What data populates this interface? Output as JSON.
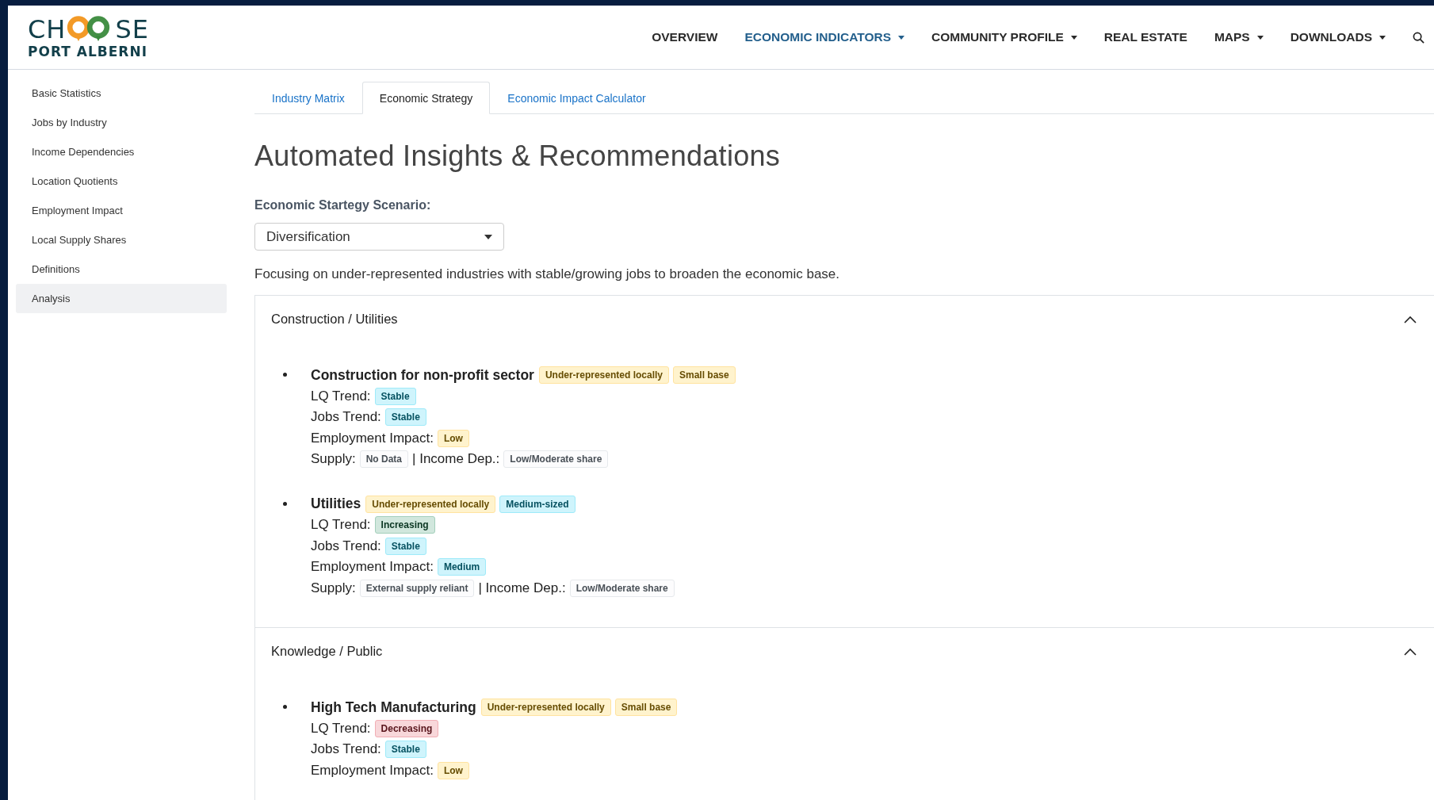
{
  "logo": {
    "before": "CH",
    "after": "SE",
    "subtitle": "PORT ALBERNI"
  },
  "nav": [
    {
      "label": "OVERVIEW",
      "selected": false,
      "dropdown": false
    },
    {
      "label": "ECONOMIC INDICATORS",
      "selected": true,
      "dropdown": true
    },
    {
      "label": "COMMUNITY PROFILE",
      "selected": false,
      "dropdown": true
    },
    {
      "label": "REAL ESTATE",
      "selected": false,
      "dropdown": false
    },
    {
      "label": "MAPS",
      "selected": false,
      "dropdown": true
    },
    {
      "label": "DOWNLOADS",
      "selected": false,
      "dropdown": true
    }
  ],
  "sidebar": {
    "items": [
      {
        "label": "Basic Statistics",
        "selected": false
      },
      {
        "label": "Jobs by Industry",
        "selected": false
      },
      {
        "label": "Income Dependencies",
        "selected": false
      },
      {
        "label": "Location Quotients",
        "selected": false
      },
      {
        "label": "Employment Impact",
        "selected": false
      },
      {
        "label": "Local Supply Shares",
        "selected": false
      },
      {
        "label": "Definitions",
        "selected": false
      },
      {
        "label": "Analysis",
        "selected": true
      }
    ]
  },
  "tabs": [
    {
      "label": "Industry Matrix",
      "selected": false
    },
    {
      "label": "Economic Strategy",
      "selected": true
    },
    {
      "label": "Economic Impact Calculator",
      "selected": false
    }
  ],
  "heading": "Automated Insights & Recommendations",
  "scenario": {
    "label": "Economic Startegy Scenario:",
    "value": "Diversification"
  },
  "description": "Focusing on under-represented industries with stable/growing jobs to broaden the economic base.",
  "sections": [
    {
      "title": "Construction / Utilities",
      "expanded": true,
      "items": [
        {
          "name": "Construction for non-profit sector",
          "tags": [
            {
              "text": "Under-represented locally",
              "kind": "warning"
            },
            {
              "text": "Small base",
              "kind": "warning"
            }
          ],
          "lines": [
            {
              "parts": [
                {
                  "label": "LQ Trend:",
                  "badge": {
                    "text": "Stable",
                    "kind": "info"
                  }
                }
              ]
            },
            {
              "parts": [
                {
                  "label": "Jobs Trend:",
                  "badge": {
                    "text": "Stable",
                    "kind": "info"
                  }
                }
              ]
            },
            {
              "parts": [
                {
                  "label": "Employment Impact:",
                  "badge": {
                    "text": "Low",
                    "kind": "warning"
                  }
                }
              ]
            },
            {
              "parts": [
                {
                  "label": "Supply:",
                  "badge": {
                    "text": "No Data",
                    "kind": "light"
                  }
                },
                {
                  "label": "| Income Dep.:",
                  "badge": {
                    "text": "Low/Moderate share",
                    "kind": "light"
                  }
                }
              ]
            }
          ]
        },
        {
          "name": "Utilities",
          "tags": [
            {
              "text": "Under-represented locally",
              "kind": "warning"
            },
            {
              "text": "Medium-sized",
              "kind": "info"
            }
          ],
          "lines": [
            {
              "parts": [
                {
                  "label": "LQ Trend:",
                  "badge": {
                    "text": "Increasing",
                    "kind": "success"
                  }
                }
              ]
            },
            {
              "parts": [
                {
                  "label": "Jobs Trend:",
                  "badge": {
                    "text": "Stable",
                    "kind": "info"
                  }
                }
              ]
            },
            {
              "parts": [
                {
                  "label": "Employment Impact:",
                  "badge": {
                    "text": "Medium",
                    "kind": "info"
                  }
                }
              ]
            },
            {
              "parts": [
                {
                  "label": "Supply:",
                  "badge": {
                    "text": "External supply reliant",
                    "kind": "light"
                  }
                },
                {
                  "label": "| Income Dep.:",
                  "badge": {
                    "text": "Low/Moderate share",
                    "kind": "light"
                  }
                }
              ]
            }
          ]
        }
      ]
    },
    {
      "title": "Knowledge / Public",
      "expanded": true,
      "items": [
        {
          "name": "High Tech Manufacturing",
          "tags": [
            {
              "text": "Under-represented locally",
              "kind": "warning"
            },
            {
              "text": "Small base",
              "kind": "warning"
            }
          ],
          "lines": [
            {
              "parts": [
                {
                  "label": "LQ Trend:",
                  "badge": {
                    "text": "Decreasing",
                    "kind": "danger"
                  }
                }
              ]
            },
            {
              "parts": [
                {
                  "label": "Jobs Trend:",
                  "badge": {
                    "text": "Stable",
                    "kind": "info"
                  }
                }
              ]
            },
            {
              "parts": [
                {
                  "label": "Employment Impact:",
                  "badge": {
                    "text": "Low",
                    "kind": "warning"
                  }
                }
              ]
            }
          ]
        }
      ]
    }
  ]
}
